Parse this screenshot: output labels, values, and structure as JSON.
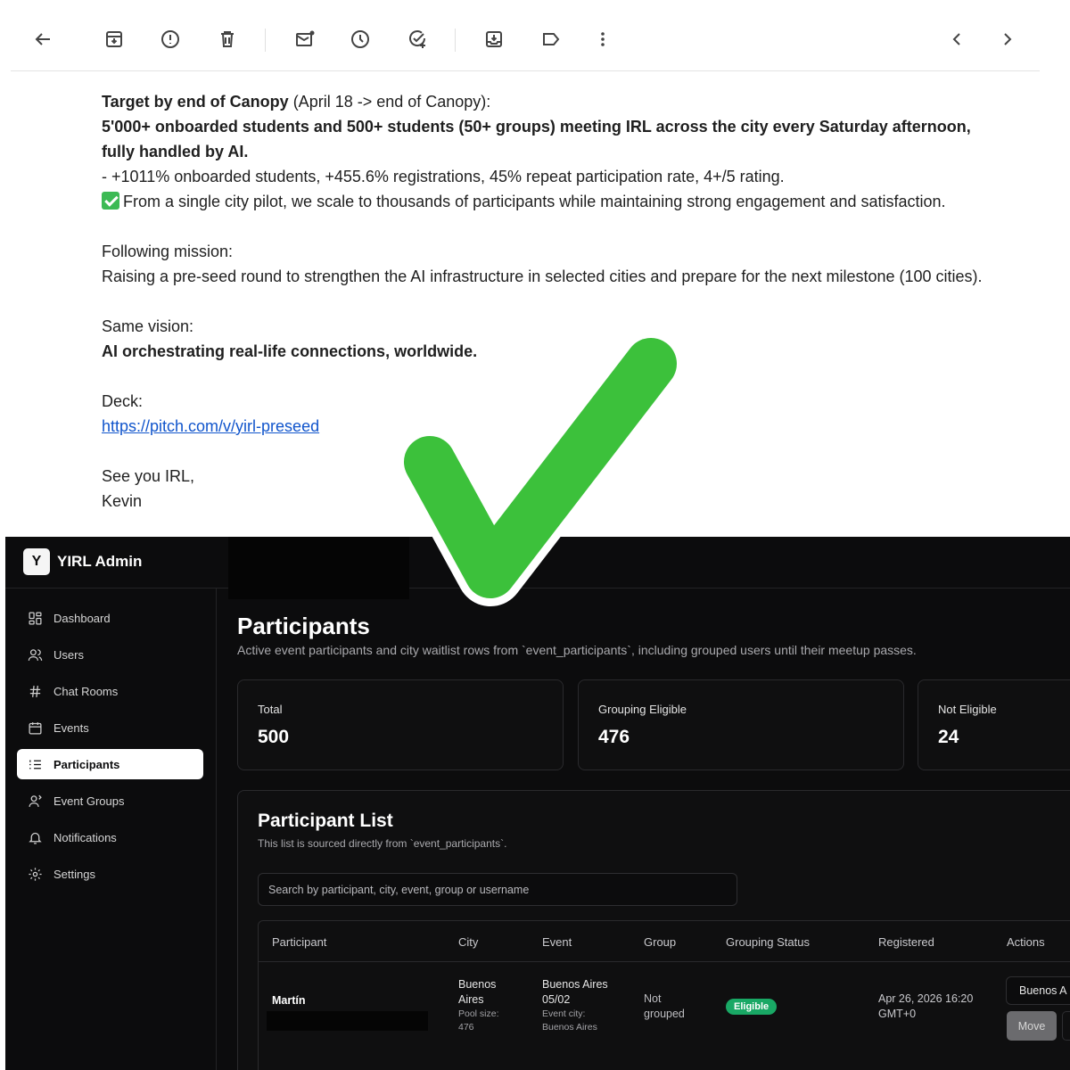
{
  "email": {
    "toolbar": {
      "back": "back-arrow-icon",
      "archive": "archive-icon",
      "spam": "report-spam-icon",
      "delete": "trash-icon",
      "unread": "mark-unread-icon",
      "snooze": "snooze-clock-icon",
      "task": "add-task-icon",
      "move": "move-to-icon",
      "label": "label-icon",
      "more": "more-vertical-icon",
      "prev": "chevron-left-icon",
      "next": "chevron-right-icon"
    },
    "target_heading": "Target by end of Canopy",
    "target_range": " (April 18 -> end of Canopy):",
    "goal_line1": "5'000+ onboarded students and 500+ students (50+ groups) meeting IRL across the city every Saturday afternoon,",
    "goal_line2": "fully handled by AI.",
    "metrics": "- +1011% onboarded students, +455.6% registrations, 45% repeat participation rate, 4+/5 rating.",
    "scale": "From a single city pilot, we scale to thousands of participants while maintaining strong engagement and satisfaction.",
    "mission_label": "Following mission:",
    "mission_text": "Raising a pre-seed round to strengthen the AI infrastructure in selected cities and prepare for the next milestone (100 cities).",
    "vision_label": "Same vision:",
    "vision_text": "AI orchestrating real-life connections, worldwide.",
    "deck_label": "Deck:",
    "deck_link": "https://pitch.com/v/yirl-preseed",
    "signoff": "See you IRL,",
    "signature": "Kevin"
  },
  "admin": {
    "brand_logo": "Y",
    "brand_name": "YIRL Admin",
    "nav": [
      {
        "label": "Dashboard",
        "icon": "dashboard-icon"
      },
      {
        "label": "Users",
        "icon": "users-icon"
      },
      {
        "label": "Chat Rooms",
        "icon": "hash-icon"
      },
      {
        "label": "Events",
        "icon": "calendar-icon"
      },
      {
        "label": "Participants",
        "icon": "list-icon",
        "active": true
      },
      {
        "label": "Event Groups",
        "icon": "group-icon"
      },
      {
        "label": "Notifications",
        "icon": "bell-icon"
      },
      {
        "label": "Settings",
        "icon": "gear-icon"
      }
    ],
    "page_title": "Participants",
    "page_subtitle": "Active event participants and city waitlist rows from `event_participants`, including grouped users until their meetup passes.",
    "stats": [
      {
        "label": "Total",
        "value": "500"
      },
      {
        "label": "Grouping Eligible",
        "value": "476"
      },
      {
        "label": "Not Eligible",
        "value": "24"
      }
    ],
    "list_title": "Participant List",
    "list_subtitle": "This list is sourced directly from `event_participants`.",
    "search_placeholder": "Search by participant, city, event, group or username",
    "columns": [
      "Participant",
      "City",
      "Event",
      "Group",
      "Grouping Status",
      "Registered",
      "Actions"
    ],
    "row": {
      "participant": "Martín",
      "city": "Buenos Aires",
      "city_line1": "Buenos",
      "city_line2": "Aires",
      "pool_label": "Pool size:",
      "pool_value": "476",
      "event_line1": "Buenos Aires",
      "event_line2": "05/02",
      "event_city_label": "Event city:",
      "event_city_value": "Buenos Aires",
      "group_line1": "Not",
      "group_line2": "grouped",
      "status": "Eligible",
      "registered_line1": "Apr 26, 2026 16:20",
      "registered_line2": "GMT+0",
      "action_select": "Buenos A",
      "action_button": "Move"
    },
    "colors": {
      "background": "#0c0c0d",
      "eligible_badge": "#19a865",
      "checkmark": "#3cc13b"
    }
  }
}
